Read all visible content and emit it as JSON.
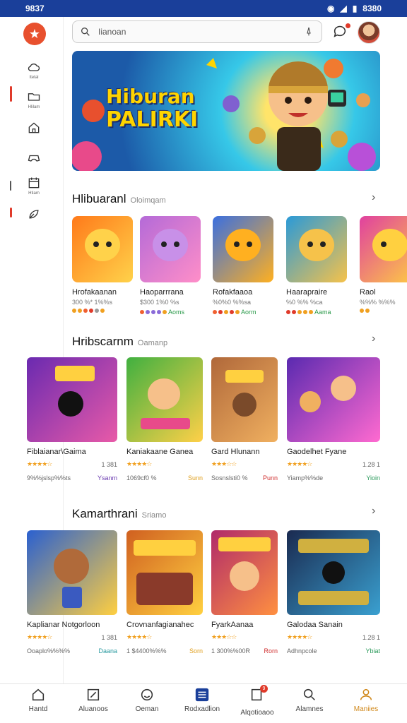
{
  "status": {
    "time": "9837",
    "right_text": "8380"
  },
  "search": {
    "text": "Iianoan"
  },
  "banner": {
    "line1": "Hiburan",
    "line2": "PALIRKI"
  },
  "sidebar": {
    "items": [
      {
        "icon": "cloud-icon",
        "label": "Itetal"
      },
      {
        "icon": "folder-icon",
        "label": "Hlilam"
      },
      {
        "icon": "house-icon",
        "label": ""
      },
      {
        "icon": "controller-icon",
        "label": ""
      },
      {
        "icon": "calendar-icon",
        "label": "Htiam"
      },
      {
        "icon": "leaf-icon",
        "label": ""
      }
    ]
  },
  "section1": {
    "title": "Hlibuaranl",
    "sub": "Oloimqam",
    "apps": [
      {
        "name": "Hrofakaanan",
        "meta": "300 %* 1%%s",
        "rating": "",
        "colors": [
          "#ff7a1a",
          "#ffd24a"
        ]
      },
      {
        "name": "Haoparrrana",
        "meta": "$300 1%0 %s",
        "rating": "Aoms",
        "colors": [
          "#b46ad8",
          "#ff8ec8"
        ]
      },
      {
        "name": "Rofakfaaoa",
        "meta": "%0%0 %%sa",
        "rating": "Aorm",
        "colors": [
          "#3a6fe0",
          "#ffb020"
        ]
      },
      {
        "name": "Haarapraire",
        "meta": "%0 %% %ca",
        "rating": "Aama",
        "colors": [
          "#2a9ad8",
          "#f6c24a"
        ]
      },
      {
        "name": "Raol",
        "meta": "%%% %%%",
        "rating": "",
        "colors": [
          "#e040a0",
          "#ffd040"
        ]
      }
    ]
  },
  "section2": {
    "title": "Hribscarnm",
    "sub": "Oamanp",
    "games": [
      {
        "title": "Fiblaianar\\Gaima",
        "price": "1 381",
        "sub": "9%%jslsp%%ts",
        "tag": "Ysanm",
        "tag_color": "#6a3ab0",
        "colors": [
          "#6a2ab0",
          "#e85aa8"
        ]
      },
      {
        "title": "Kaniakaane Ganea",
        "price": "",
        "sub": "1069cf0 %",
        "tag": "Sunn",
        "tag_color": "#e0a020",
        "colors": [
          "#40b040",
          "#ffd048"
        ]
      },
      {
        "title": "Gard Hlunann",
        "price": "",
        "sub": "Sosnslsti0 %",
        "tag": "Punn",
        "tag_color": "#d03030",
        "colors": [
          "#b0683a",
          "#f0b060"
        ]
      },
      {
        "title": "Gaodelhet Fyane",
        "price": "1.28 1",
        "sub": "Yiamp%%de",
        "tag": "Yioin",
        "tag_color": "#2a9a5a",
        "colors": [
          "#5a2ab0",
          "#ff6ad0"
        ]
      }
    ]
  },
  "section3": {
    "title": "Kamarthrani",
    "sub": "Sriamo",
    "games": [
      {
        "title": "Kaplianar Notgorloon",
        "price": "1 381",
        "sub": "Ooaplo%%%%",
        "tag": "Daana",
        "tag_color": "#2a9aa0",
        "colors": [
          "#2a60d0",
          "#ffcf40"
        ]
      },
      {
        "title": "Crovnanfagianahec",
        "price": "",
        "sub": "1 $4400%%%",
        "tag": "Sorn",
        "tag_color": "#e0a020",
        "colors": [
          "#d06020",
          "#ffd040"
        ]
      },
      {
        "title": "FyarkAanaa",
        "price": "",
        "sub": "1 300%%00R",
        "tag": "Rorn",
        "tag_color": "#d03030",
        "colors": [
          "#b02a6a",
          "#ff9040"
        ]
      },
      {
        "title": "Galodaa Sanain",
        "price": "1.28 1",
        "sub": "Adhnpcole",
        "tag": "Ybiat",
        "tag_color": "#2a9a5a",
        "colors": [
          "#1a2a50",
          "#3aa0d0"
        ]
      }
    ]
  },
  "bottom_nav": [
    {
      "label": "Hantd",
      "icon": "home-icon"
    },
    {
      "label": "Aluanoos",
      "icon": "edit-icon"
    },
    {
      "label": "Oeman",
      "icon": "smile-icon"
    },
    {
      "label": "Rodxadlion",
      "icon": "equalizer-icon"
    },
    {
      "label": "Alqotioaoo",
      "icon": "bell-icon",
      "badge": "9"
    },
    {
      "label": "Alamnes",
      "icon": "search-icon"
    },
    {
      "label": "Maniies",
      "icon": "profile-icon"
    }
  ],
  "colors": {
    "accent": "#1a3f9a",
    "brand": "#e8502e",
    "active_nav": "#d0881a"
  }
}
